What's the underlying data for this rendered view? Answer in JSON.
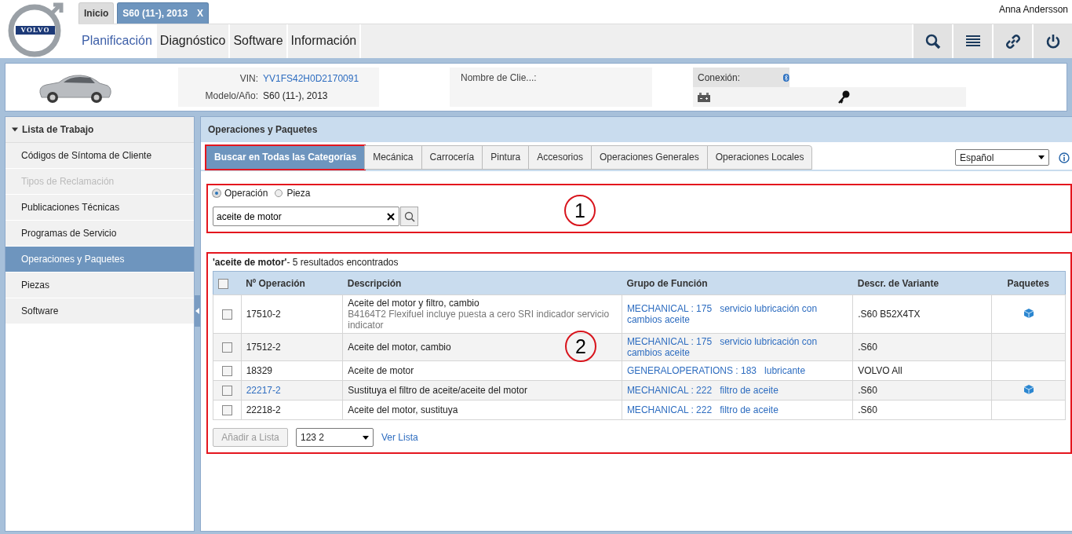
{
  "header": {
    "logo_text": "VOLVO",
    "user": "Anna Andersson",
    "app_tabs": [
      {
        "label": "Inicio",
        "selected": false
      },
      {
        "label": "S60 (11-), 2013",
        "close": "X",
        "selected": true
      }
    ],
    "main_menu": [
      {
        "label": "Planificación",
        "selected": true
      },
      {
        "label": "Diagnóstico",
        "selected": false
      },
      {
        "label": "Software",
        "selected": false
      },
      {
        "label": "Información",
        "selected": false
      }
    ],
    "toolbar": [
      {
        "kind": "search"
      },
      {
        "kind": "list"
      },
      {
        "kind": "link"
      },
      {
        "kind": "power"
      }
    ]
  },
  "vehicle": {
    "vin_label": "VIN:",
    "vin": "YV1FS42H0D2170091",
    "model_label": "Modelo/Año:",
    "model": "S60 (11-), 2013",
    "customer_label": "Nombre de Clie...:",
    "connection_label": "Conexión:"
  },
  "sidebar": {
    "title": "Lista de Trabajo",
    "expanded": true,
    "items": [
      {
        "label": "Códigos de Síntoma de Cliente",
        "selected": false,
        "disabled": false
      },
      {
        "label": "Tipos de Reclamación",
        "selected": false,
        "disabled": true
      },
      {
        "label": "Publicaciones Técnicas",
        "selected": false,
        "disabled": false
      },
      {
        "label": "Programas de Servicio",
        "selected": false,
        "disabled": false
      },
      {
        "label": "Operaciones y Paquetes",
        "selected": true,
        "disabled": false
      },
      {
        "label": "Piezas",
        "selected": false,
        "disabled": false
      },
      {
        "label": "Software",
        "selected": false,
        "disabled": false
      }
    ]
  },
  "panel": {
    "title": "Operaciones y Paquetes",
    "category_tabs": [
      {
        "label": "Buscar en Todas las Categorías",
        "selected": true,
        "highlighted": true
      },
      {
        "label": "Mecánica",
        "selected": false,
        "highlighted": false
      },
      {
        "label": "Carrocería",
        "selected": false,
        "highlighted": false
      },
      {
        "label": "Pintura",
        "selected": false,
        "highlighted": false
      },
      {
        "label": "Accesorios",
        "selected": false,
        "highlighted": false
      },
      {
        "label": "Operaciones Generales",
        "selected": false,
        "highlighted": false
      },
      {
        "label": "Operaciones Locales",
        "selected": false,
        "highlighted": false
      }
    ],
    "language": "Español",
    "search": {
      "callout": "1",
      "search_type": [
        {
          "label": "Operación",
          "selected": true
        },
        {
          "label": "Pieza",
          "selected": false
        }
      ],
      "query": "aceite de motor"
    },
    "results": {
      "callout": "2",
      "query": "'aceite de motor'",
      "summary": "- 5 resultados encontrados",
      "header_checked": false,
      "columns": [
        "Nº Operación",
        "Descripción",
        "Grupo de Función",
        "Descr. de Variante",
        "Paquetes"
      ],
      "rows": [
        {
          "checked": false,
          "operation": "17510-2",
          "operation_link": false,
          "description": "Aceite del motor y filtro, cambio",
          "detail": "B4164T2 Flexifuel incluye puesta a cero SRI indicador servicio indicator",
          "function_group": "MECHANICAL : 175   servicio lubricación con cambios aceite",
          "variant": ".S60 B52X4TX",
          "package": true
        },
        {
          "checked": false,
          "operation": "17512-2",
          "operation_link": false,
          "description": "Aceite del motor, cambio",
          "function_group": "MECHANICAL : 175   servicio lubricación con cambios aceite",
          "variant": ".S60",
          "package": false
        },
        {
          "checked": false,
          "operation": "18329",
          "operation_link": false,
          "description": "Aceite de motor",
          "function_group": "GENERALOPERATIONS : 183   lubricante",
          "variant": "VOLVO All",
          "package": false
        },
        {
          "checked": false,
          "operation": "22217-2",
          "operation_link": true,
          "description": "Sustituya el filtro de aceite/aceite del motor",
          "function_group": "MECHANICAL : 222   filtro de aceite",
          "variant": ".S60",
          "package": true
        },
        {
          "checked": false,
          "operation": "22218-2",
          "operation_link": false,
          "description": "Aceite del motor, sustituya",
          "function_group": "MECHANICAL : 222   filtro de aceite",
          "variant": ".S60",
          "package": false
        }
      ],
      "add_button": {
        "label": "Añadir a Lista",
        "disabled": true
      },
      "list_select": "123 2",
      "view_link": "Ver Lista"
    }
  }
}
